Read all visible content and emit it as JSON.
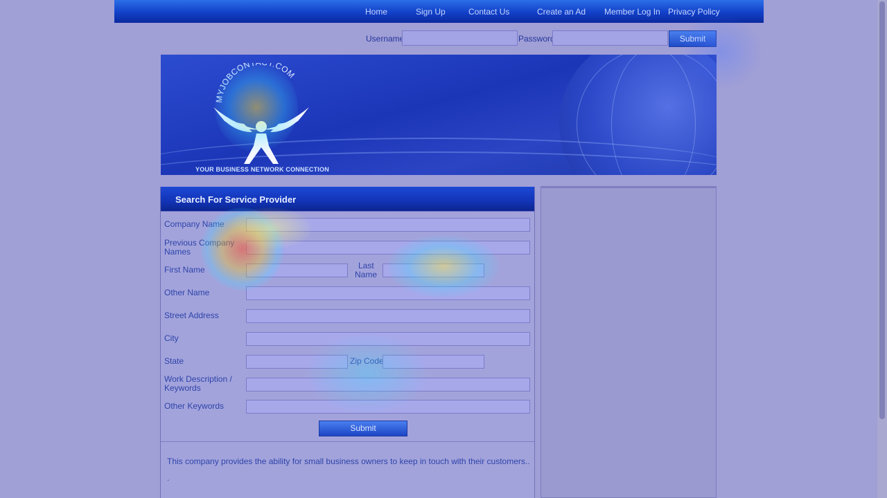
{
  "nav": {
    "home": "Home",
    "sign_up": "Sign Up",
    "contact_us": "Contact Us",
    "create_ad": "Create an Ad",
    "member_login": "Member Log In",
    "privacy_policy": "Privacy Policy"
  },
  "login": {
    "username_label": "Username",
    "password_label": "Password",
    "username_value": "",
    "password_value": "",
    "submit_label": "Submit"
  },
  "banner": {
    "logo_arc_text": "MYJOBCONTACT.COM",
    "tagline": "YOUR BUSINESS NETWORK CONNECTION"
  },
  "search": {
    "title": "Search For Service Provider",
    "fields": {
      "company_name": "Company Name",
      "previous_company_names_1": "Previous Company",
      "previous_company_names_2": "Names",
      "first_name": "First Name",
      "last_name_1": "Last",
      "last_name_2": "Name",
      "other_name": "Other Name",
      "street_address": "Street Address",
      "city": "City",
      "state": "State",
      "zip_code": "Zip Code",
      "work_description_1": "Work Description /",
      "work_description_2": "Keywords",
      "other_keywords": "Other Keywords"
    },
    "submit_label": "Submit",
    "description": "This company provides the ability for small business owners to keep in touch with their customers..",
    "dot": "."
  },
  "colors": {
    "nav_bar": "#1240c8",
    "panel_header": "#1234b6",
    "label_text": "#2d44a8",
    "page_bg": "#a09fd6"
  }
}
